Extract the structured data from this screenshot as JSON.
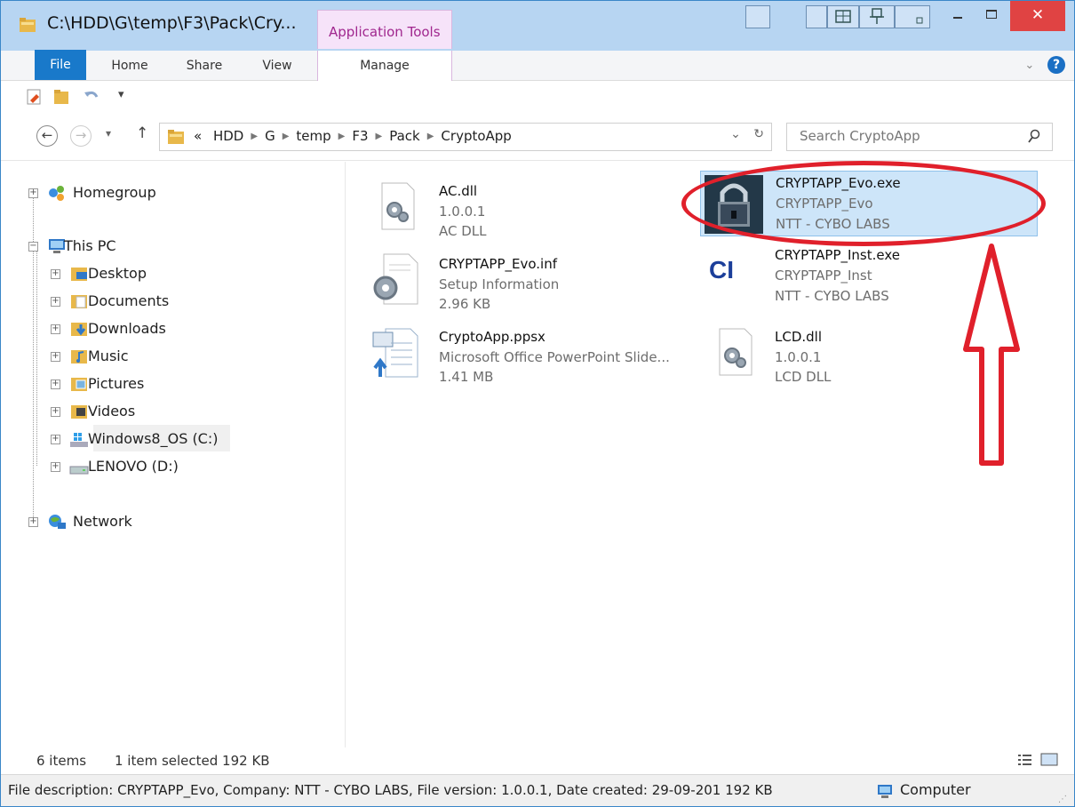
{
  "window": {
    "title": "C:\\HDD\\G\\temp\\F3\\Pack\\Cry...",
    "context_tab": "Application Tools",
    "close_glyph": "✕",
    "accent": "#1979ca",
    "close_color": "#e04343"
  },
  "ribbon": {
    "tabs": [
      "File",
      "Home",
      "Share",
      "View",
      "Manage"
    ],
    "help": "?",
    "expand": "⌄"
  },
  "quick_access": {
    "customize": "▾"
  },
  "address": {
    "back": "←",
    "forward": "→",
    "recent": "▾",
    "up": "↑",
    "overflow": "«",
    "crumbs": [
      "HDD",
      "G",
      "temp",
      "F3",
      "Pack",
      "CryptoApp"
    ],
    "dropdown": "⌄",
    "refresh": "↻"
  },
  "search": {
    "placeholder": "Search CryptoApp"
  },
  "nav": {
    "homegroup": "Homegroup",
    "this_pc": "This PC",
    "children": [
      "Desktop",
      "Documents",
      "Downloads",
      "Music",
      "Pictures",
      "Videos",
      "Windows8_OS (C:)",
      "LENOVO (D:)"
    ],
    "network": "Network"
  },
  "files": [
    {
      "name": "AC.dll",
      "line2": "1.0.0.1",
      "line3": "AC DLL",
      "icon": "dll-gear-icon"
    },
    {
      "name": "CRYPTAPP_Evo.exe",
      "line2": "CRYPTAPP_Evo",
      "line3": "NTT - CYBO LABS",
      "icon": "padlock-app-icon",
      "selected": true
    },
    {
      "name": "CRYPTAPP_Evo.inf",
      "line2": "Setup Information",
      "line3": "2.96 KB",
      "icon": "setup-info-icon"
    },
    {
      "name": "CRYPTAPP_Inst.exe",
      "line2": "CRYPTAPP_Inst",
      "line3": "NTT - CYBO LABS",
      "icon": "ci-logo-icon",
      "icon_text": "CI"
    },
    {
      "name": "CryptoApp.ppsx",
      "line2": "Microsoft Office PowerPoint Slide...",
      "line3": "1.41 MB",
      "icon": "powerpoint-show-icon"
    },
    {
      "name": "LCD.dll",
      "line2": "1.0.0.1",
      "line3": "LCD DLL",
      "icon": "dll-gear-icon"
    }
  ],
  "status": {
    "count": "6 items",
    "selection": "1 item selected  192 KB"
  },
  "details": {
    "description": "File description: CRYPTAPP_Evo, Company: NTT - CYBO LABS, File version: 1.0.0.1, Date created: 29-09-201  192 KB",
    "zone": "Computer"
  },
  "annotation": {
    "color": "#e0202b"
  }
}
